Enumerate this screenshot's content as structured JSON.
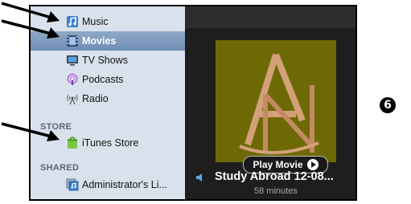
{
  "sidebar": {
    "library": [
      {
        "label": "Music",
        "icon": "music-note-icon"
      },
      {
        "label": "Movies",
        "icon": "film-icon",
        "selected": true
      },
      {
        "label": "TV Shows",
        "icon": "tv-icon"
      },
      {
        "label": "Podcasts",
        "icon": "podcast-icon"
      },
      {
        "label": "Radio",
        "icon": "radio-antenna-icon"
      }
    ],
    "store_heading": "STORE",
    "store_item": {
      "label": "iTunes Store",
      "icon": "shopping-bag-icon"
    },
    "shared_heading": "SHARED",
    "shared_item": {
      "label": "Administrator's Li...",
      "icon": "shared-library-icon"
    }
  },
  "main": {
    "artwork_letters": "AN",
    "play_button": "Play Movie",
    "title": "Study Abroad 12-08...",
    "duration": "58 minutes"
  },
  "step_marker": "❻",
  "colors": {
    "sidebar_bg": "#d9e2ec",
    "selected_bg": "#7a96ba",
    "main_bg": "#1e1e1e",
    "artwork_bg": "#6d6a06",
    "artwork_letter": "#d4a07a"
  }
}
